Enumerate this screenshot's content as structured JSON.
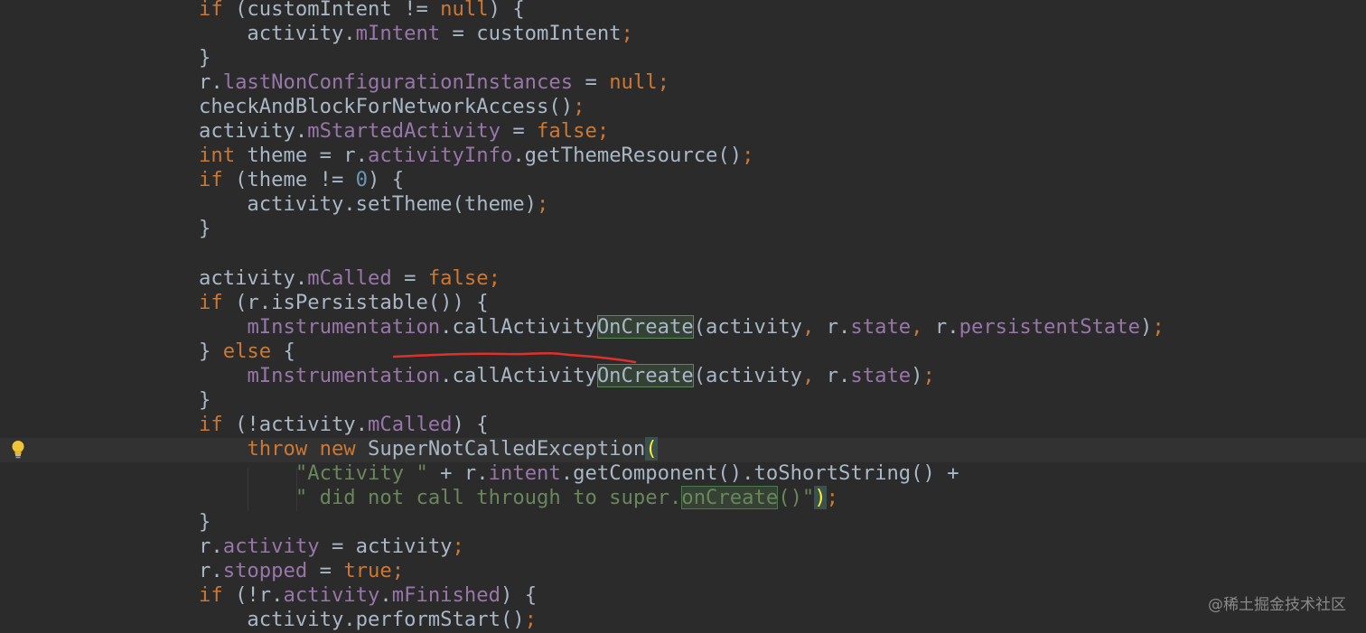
{
  "editor": {
    "language": "Java",
    "theme": "Darcula"
  },
  "code_lines": [
    [
      [
        "kw",
        "if"
      ],
      [
        "t",
        " (customIntent != "
      ],
      [
        "kw",
        "null"
      ],
      [
        "t",
        ") {"
      ]
    ],
    [
      [
        "t",
        "    activity."
      ],
      [
        "fld",
        "mIntent"
      ],
      [
        "t",
        " = customIntent"
      ],
      [
        "kw",
        ";"
      ]
    ],
    [
      [
        "t",
        "}"
      ]
    ],
    [
      [
        "t",
        "r."
      ],
      [
        "fld",
        "lastNonConfigurationInstances"
      ],
      [
        "t",
        " = "
      ],
      [
        "kw",
        "null;"
      ]
    ],
    [
      [
        "t",
        "checkAndBlockForNetworkAccess()"
      ],
      [
        "kw",
        ";"
      ]
    ],
    [
      [
        "t",
        "activity."
      ],
      [
        "fld",
        "mStartedActivity"
      ],
      [
        "t",
        " = "
      ],
      [
        "kw",
        "false;"
      ]
    ],
    [
      [
        "kw",
        "int"
      ],
      [
        "t",
        " theme = r."
      ],
      [
        "fld",
        "activityInfo"
      ],
      [
        "t",
        ".getThemeResource()"
      ],
      [
        "kw",
        ";"
      ]
    ],
    [
      [
        "kw",
        "if"
      ],
      [
        "t",
        " (theme != "
      ],
      [
        "num",
        "0"
      ],
      [
        "t",
        ") {"
      ]
    ],
    [
      [
        "t",
        "    activity.setTheme(theme)"
      ],
      [
        "kw",
        ";"
      ]
    ],
    [
      [
        "t",
        "}"
      ]
    ],
    [],
    [
      [
        "t",
        "activity."
      ],
      [
        "fld",
        "mCalled"
      ],
      [
        "t",
        " = "
      ],
      [
        "kw",
        "false;"
      ]
    ],
    [
      [
        "kw",
        "if"
      ],
      [
        "t",
        " (r.isPersistable()) {"
      ]
    ],
    [
      [
        "t",
        "    "
      ],
      [
        "fld",
        "mInstrumentation"
      ],
      [
        "t",
        ".callActivity"
      ],
      [
        "hl",
        "OnCreate"
      ],
      [
        "t",
        "(activity"
      ],
      [
        "kw",
        ","
      ],
      [
        "t",
        " r."
      ],
      [
        "fld",
        "state"
      ],
      [
        "kw",
        ","
      ],
      [
        "t",
        " r."
      ],
      [
        "fld",
        "persistentState"
      ],
      [
        "t",
        ")"
      ],
      [
        "kw",
        ";"
      ]
    ],
    [
      [
        "t",
        "} "
      ],
      [
        "kw",
        "else"
      ],
      [
        "t",
        " {"
      ]
    ],
    [
      [
        "t",
        "    "
      ],
      [
        "fld",
        "mInstrumentation"
      ],
      [
        "t",
        ".callActivity"
      ],
      [
        "hl",
        "OnCreate"
      ],
      [
        "t",
        "(activity"
      ],
      [
        "kw",
        ","
      ],
      [
        "t",
        " r."
      ],
      [
        "fld",
        "state"
      ],
      [
        "t",
        ")"
      ],
      [
        "kw",
        ";"
      ]
    ],
    [
      [
        "t",
        "}"
      ]
    ],
    [
      [
        "kw",
        "if"
      ],
      [
        "t",
        " (!activity."
      ],
      [
        "fld",
        "mCalled"
      ],
      [
        "t",
        ") {"
      ]
    ],
    [
      [
        "t",
        "    "
      ],
      [
        "kw",
        "throw new"
      ],
      [
        "t",
        " SuperNotCalledException"
      ],
      [
        "pm",
        "("
      ]
    ],
    [
      [
        "t",
        "        "
      ],
      [
        "str",
        "\"Activity \""
      ],
      [
        "t",
        " + r."
      ],
      [
        "fld",
        "intent"
      ],
      [
        "t",
        ".getComponent().toShortString() +"
      ]
    ],
    [
      [
        "t",
        "        "
      ],
      [
        "str",
        "\" did not call through to super."
      ],
      [
        "hls",
        "onCreate"
      ],
      [
        "str",
        "()\""
      ],
      [
        "pm",
        ")"
      ],
      [
        "kw",
        ";"
      ]
    ],
    [
      [
        "t",
        "}"
      ]
    ],
    [
      [
        "t",
        "r."
      ],
      [
        "fld",
        "activity"
      ],
      [
        "t",
        " = activity"
      ],
      [
        "kw",
        ";"
      ]
    ],
    [
      [
        "t",
        "r."
      ],
      [
        "fld",
        "stopped"
      ],
      [
        "t",
        " = "
      ],
      [
        "kw",
        "true;"
      ]
    ],
    [
      [
        "kw",
        "if"
      ],
      [
        "t",
        " (!r."
      ],
      [
        "fld",
        "activity"
      ],
      [
        "t",
        "."
      ],
      [
        "fld",
        "mFinished"
      ],
      [
        "t",
        ") {"
      ]
    ],
    [
      [
        "t",
        "    activity.performStart()"
      ],
      [
        "kw",
        ";"
      ]
    ]
  ],
  "gutter": {
    "intention_icon": "lightbulb-icon"
  },
  "annotation": {
    "type": "freehand-underline",
    "color": "#e0302c"
  },
  "watermark": {
    "text": "@稀土掘金技术社区"
  }
}
